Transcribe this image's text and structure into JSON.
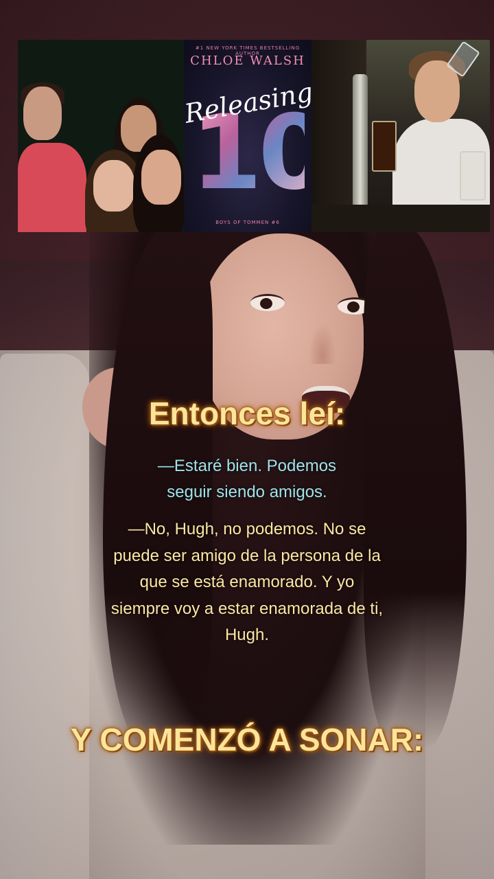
{
  "collage": {
    "book": {
      "author_top": "#1 NEW YORK TIMES BESTSELLING AUTHOR",
      "author": "CHLOE WALSH",
      "title": "Releasing",
      "number": "10",
      "series": "BOYS OF TOMMEN #6"
    }
  },
  "captions": {
    "heading": "Entonces leí:",
    "quote1_line1": "—Estaré bien. Podemos",
    "quote1_line2": "seguir siendo amigos.",
    "quote2": "—No, Hugh, no podemos. No se puede ser amigo de la persona de la que se está enamorado. Y yo siempre voy a estar enamorada de ti, Hugh.",
    "footer": "Y COMENZÓ A SONAR:"
  },
  "colors": {
    "heading_text": "#fbe59b",
    "heading_glow": "#c46e1a",
    "quote1_text": "#9fe3ea",
    "quote2_text": "#fbe7a3"
  }
}
